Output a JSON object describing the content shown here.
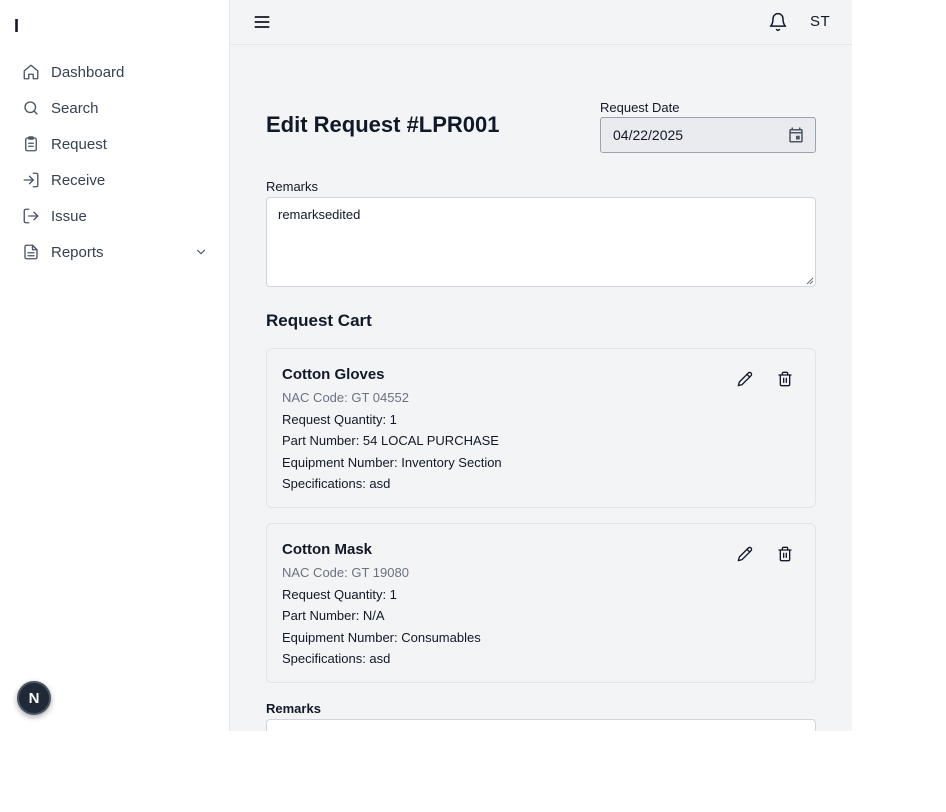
{
  "sidebar": {
    "brand": "I",
    "items": [
      {
        "label": "Dashboard",
        "icon": "home-icon"
      },
      {
        "label": "Search",
        "icon": "search-icon"
      },
      {
        "label": "Request",
        "icon": "clipboard-icon"
      },
      {
        "label": "Receive",
        "icon": "login-icon"
      },
      {
        "label": "Issue",
        "icon": "logout-icon"
      },
      {
        "label": "Reports",
        "icon": "document-icon",
        "expandable": true
      }
    ]
  },
  "floating_badge": "N",
  "header": {
    "menu_icon": "hamburger-icon",
    "bell_icon": "bell-icon",
    "avatar_initials": "ST"
  },
  "form": {
    "title": "Edit Request #LPR001",
    "request_date_label": "Request Date",
    "request_date_value": "04/22/2025",
    "remarks_label": "Remarks",
    "remarks_value": "remarksedited"
  },
  "cart": {
    "title": "Request Cart",
    "items": [
      {
        "name": "Cotton Gloves",
        "nac": "NAC Code: GT 04552",
        "quantity": "Request Quantity: 1",
        "part_number": "Part Number: 54 LOCAL PURCHASE",
        "equipment_number": "Equipment Number: Inventory Section",
        "specifications": "Specifications: asd"
      },
      {
        "name": "Cotton Mask",
        "nac": "NAC Code: GT 19080",
        "quantity": "Request Quantity: 1",
        "part_number": "Part Number: N/A",
        "equipment_number": "Equipment Number: Consumables",
        "specifications": "Specifications: asd"
      }
    ]
  },
  "item_remarks_label": "Remarks",
  "colors": {
    "main_bg": "#f3f4f6",
    "sidebar_bg": "#ffffff",
    "text": "#111827",
    "muted": "#6b7280"
  }
}
